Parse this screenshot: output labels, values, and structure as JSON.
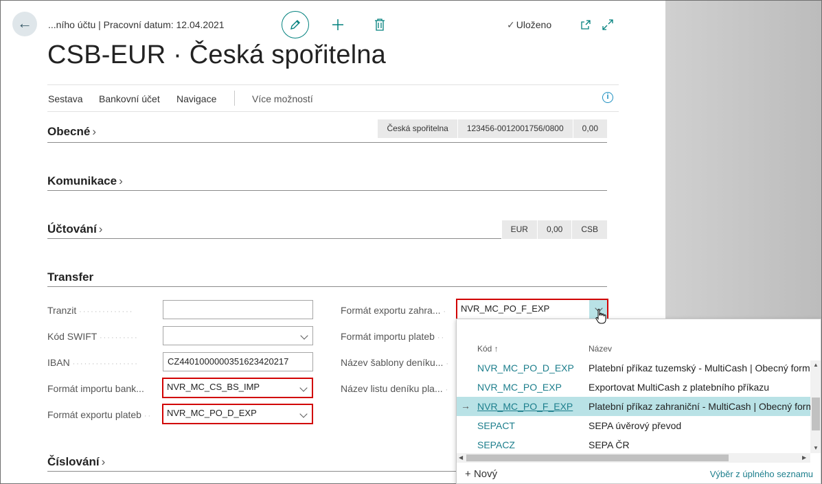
{
  "header": {
    "breadcrumb": "...ního účtu | Pracovní datum: 12.04.2021",
    "saved_status": "Uloženo",
    "title": "CSB-EUR · Česká spořitelna"
  },
  "actions": [
    "Sestava",
    "Bankovní účet",
    "Navigace",
    "Více možností"
  ],
  "sections": {
    "obecne": {
      "title": "Obecné",
      "pills": [
        "Česká spořitelna",
        "123456-0012001756/0800",
        "0,00"
      ]
    },
    "komunikace": {
      "title": "Komunikace"
    },
    "uctovani": {
      "title": "Účtování",
      "pills": [
        "EUR",
        "0,00",
        "CSB"
      ]
    },
    "transfer": {
      "title": "Transfer"
    },
    "ciselovani": {
      "title": "Číslování"
    }
  },
  "transfer_fields": {
    "tranzit": {
      "label": "Tranzit",
      "value": ""
    },
    "swift": {
      "label": "Kód SWIFT",
      "value": ""
    },
    "iban": {
      "label": "IBAN",
      "value": "CZ4401000000351623420217"
    },
    "import_bank": {
      "label": "Formát importu bank...",
      "value": "NVR_MC_CS_BS_IMP"
    },
    "export_plateb": {
      "label": "Formát exportu plateb",
      "value": "NVR_MC_PO_D_EXP"
    },
    "export_zahr": {
      "label": "Formát exportu zahra...",
      "value": "NVR_MC_PO_F_EXP"
    },
    "import_plateb": {
      "label": "Formát importu plateb"
    },
    "sablona": {
      "label": "Název šablony deníku..."
    },
    "list": {
      "label": "Název listu deníku pla..."
    }
  },
  "lookup": {
    "col_code": "Kód",
    "col_name": "Název",
    "rows": [
      {
        "code": "NVR_MC_PO_D_EXP",
        "name": "Platební příkaz tuzemský - MultiCash | Obecný formát"
      },
      {
        "code": "NVR_MC_PO_EXP",
        "name": "Exportovat MultiCash z platebního příkazu"
      },
      {
        "code": "NVR_MC_PO_F_EXP",
        "name": "Platební příkaz zahraniční - MultiCash | Obecný formát"
      },
      {
        "code": "SEPACT",
        "name": "SEPA úvěrový převod"
      },
      {
        "code": "SEPACZ",
        "name": "SEPA ČR"
      }
    ],
    "new_label": "Nový",
    "full_list_label": "Výběr z úplného seznamu"
  },
  "colors": {
    "accent": "#00807d",
    "highlight_border": "#d10000",
    "selected_row": "#b9e2e6",
    "link": "#1c7e8c"
  }
}
